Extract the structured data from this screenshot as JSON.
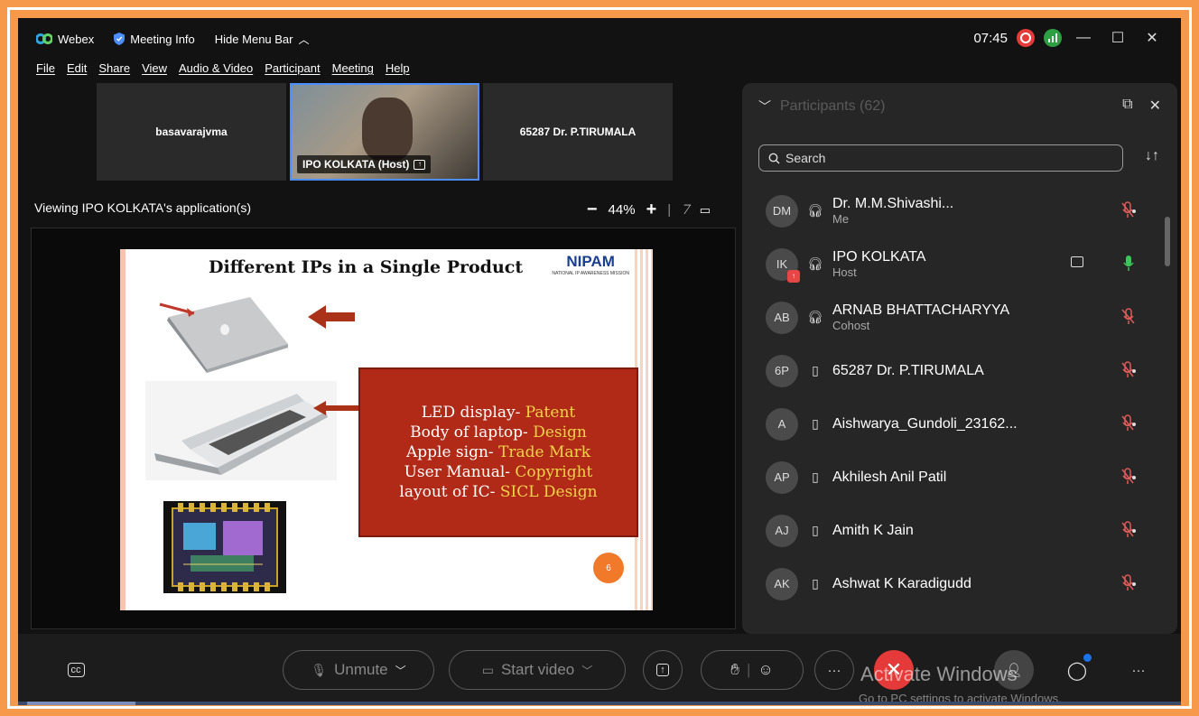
{
  "titlebar": {
    "app_name": "Webex",
    "meeting_info": "Meeting Info",
    "hide_menu": "Hide Menu Bar",
    "time": "07:45"
  },
  "menu": [
    "File",
    "Edit",
    "Share",
    "View",
    "Audio & Video",
    "Participant",
    "Meeting",
    "Help"
  ],
  "video_tiles": [
    {
      "label": "basavarajvma"
    },
    {
      "label": "IPO KOLKATA (Host)"
    },
    {
      "label": "65287 Dr. P.TIRUMALA"
    }
  ],
  "viewing": {
    "text": "Viewing IPO KOLKATA's application(s)",
    "zoom": "44%"
  },
  "slide": {
    "title": "Different IPs in a Single Product",
    "logo": "NIPAM",
    "logo_sub": "NATIONAL IP AWARENESS MISSION",
    "lines": [
      {
        "label": "LED display- ",
        "value": "Patent"
      },
      {
        "label": "Body of laptop- ",
        "value": "Design"
      },
      {
        "label": "Apple sign- ",
        "value": "Trade Mark"
      },
      {
        "label": "User Manual- ",
        "value": "Copyright"
      },
      {
        "label": "layout of IC- ",
        "value": "SICL Design"
      }
    ],
    "page_number": "6"
  },
  "participants": {
    "header": "Participants (62)",
    "search_placeholder": "Search",
    "rows": [
      {
        "initials": "DM",
        "name": "Dr. M.M.Shivashi...",
        "role": "Me",
        "device": "headset",
        "mic": "muted"
      },
      {
        "initials": "IK",
        "name": "IPO KOLKATA",
        "role": "Host",
        "device": "headset",
        "mic": "active",
        "video": true,
        "sharing": true
      },
      {
        "initials": "AB",
        "name": "ARNAB BHATTACHARYYA",
        "role": "Cohost",
        "device": "headset",
        "mic": "muted-red"
      },
      {
        "initials": "6P",
        "name": "65287 Dr. P.TIRUMALA",
        "role": "",
        "device": "mobile",
        "mic": "muted"
      },
      {
        "initials": "A",
        "name": "Aishwarya_Gundoli_23162...",
        "role": "",
        "device": "mobile",
        "mic": "muted"
      },
      {
        "initials": "AP",
        "name": "Akhilesh Anil Patil",
        "role": "",
        "device": "mobile",
        "mic": "muted"
      },
      {
        "initials": "AJ",
        "name": "Amith K Jain",
        "role": "",
        "device": "mobile",
        "mic": "muted"
      },
      {
        "initials": "AK",
        "name": "Ashwat K Karadigudd",
        "role": "",
        "device": "mobile",
        "mic": "muted"
      }
    ]
  },
  "toolbar": {
    "unmute": "Unmute",
    "start_video": "Start video"
  },
  "watermark": {
    "line1": "Activate Windows",
    "line2": "Go to PC settings to activate Windows."
  },
  "colors": {
    "frame": "#f6994a",
    "app_bg": "#121212",
    "panel_bg": "#262626",
    "end_call": "#e53a3a",
    "mute_red": "#e05a5a",
    "mic_green": "#3cc65a"
  }
}
